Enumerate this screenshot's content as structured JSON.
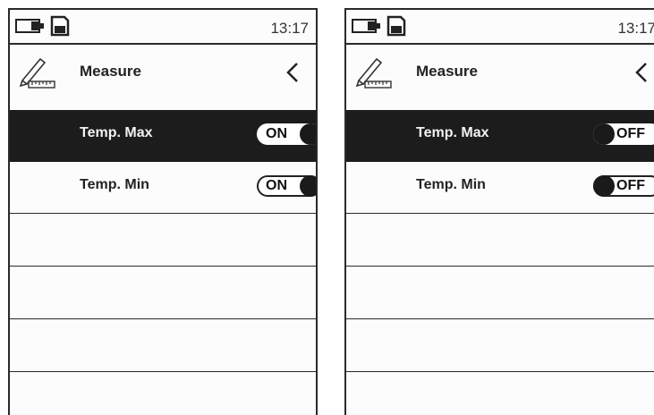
{
  "screens": [
    {
      "status": {
        "time": "13:17"
      },
      "header": {
        "title": "Measure"
      },
      "rows": [
        {
          "label": "Temp. Max",
          "toggle": "ON"
        },
        {
          "label": "Temp. Min",
          "toggle": "ON"
        }
      ]
    },
    {
      "status": {
        "time": "13:17"
      },
      "header": {
        "title": "Measure"
      },
      "rows": [
        {
          "label": "Temp. Max",
          "toggle": "OFF"
        },
        {
          "label": "Temp. Min",
          "toggle": "OFF"
        }
      ]
    }
  ],
  "icons": {
    "battery": "battery-icon",
    "sd_card": "sd-card-icon",
    "pencil_ruler": "pencil-ruler-icon",
    "back": "chevron-left-icon"
  }
}
